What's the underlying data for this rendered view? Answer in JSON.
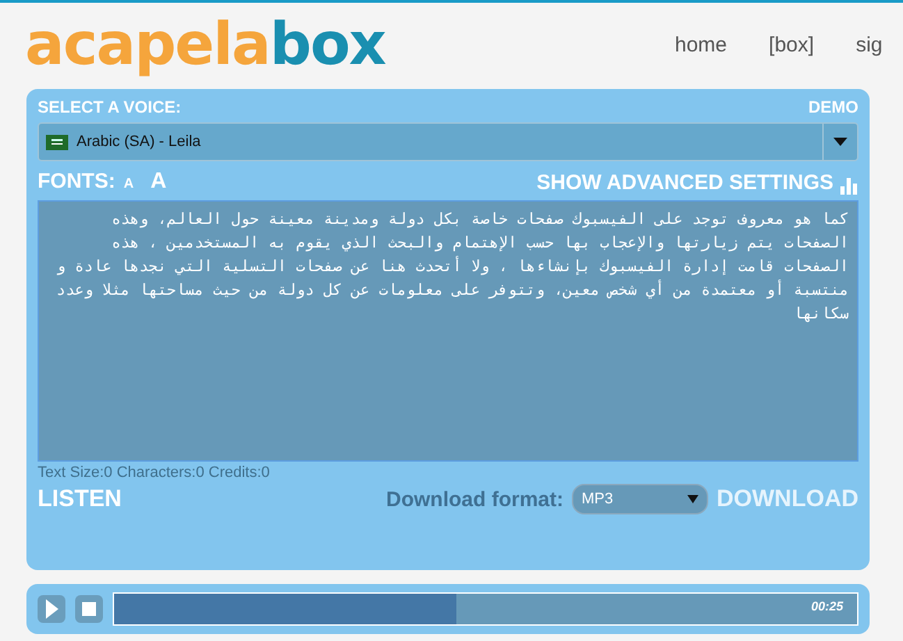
{
  "logo": {
    "part_1": "acapela",
    "part_2": "box"
  },
  "nav": [
    {
      "label": "home"
    },
    {
      "label": "[box]"
    },
    {
      "label": "sig"
    }
  ],
  "voice": {
    "heading": "SELECT A VOICE:",
    "badge": "DEMO",
    "selected_voice": "Arabic (SA) - Leila"
  },
  "fonts": {
    "label": "FONTS:",
    "small": "A",
    "large": "A"
  },
  "advanced_settings": "SHOW ADVANCED SETTINGS",
  "text": "كما هو معروف توجد على الفيسبوك صفحات خاصة بكل دولة ومدينة معينة حول العالم، وهذه الصفحات يتم زيارتها والإعجاب بها حسب الإهتمام والبحث الذي يقوم به المستخدمين ، هذه الصفحات قامت إدارة الفيسبوك بإنشاءها ، ولا أتحدث هنا عن صفحات التسلية التي نجدها عادة و منتسبة أو معتمدة من أي شخص معين، وتتوفر على معلومات عن كل دولة من حيث مساحتها مثلا وعدد سكانها",
  "stats": "Text Size:0 Characters:0 Credits:0",
  "listen": "LISTEN",
  "download": {
    "label": "Download format:",
    "format": "MP3",
    "button": "DOWNLOAD",
    "disabled": true
  },
  "player": {
    "level": 0.46,
    "time": "00:25"
  }
}
